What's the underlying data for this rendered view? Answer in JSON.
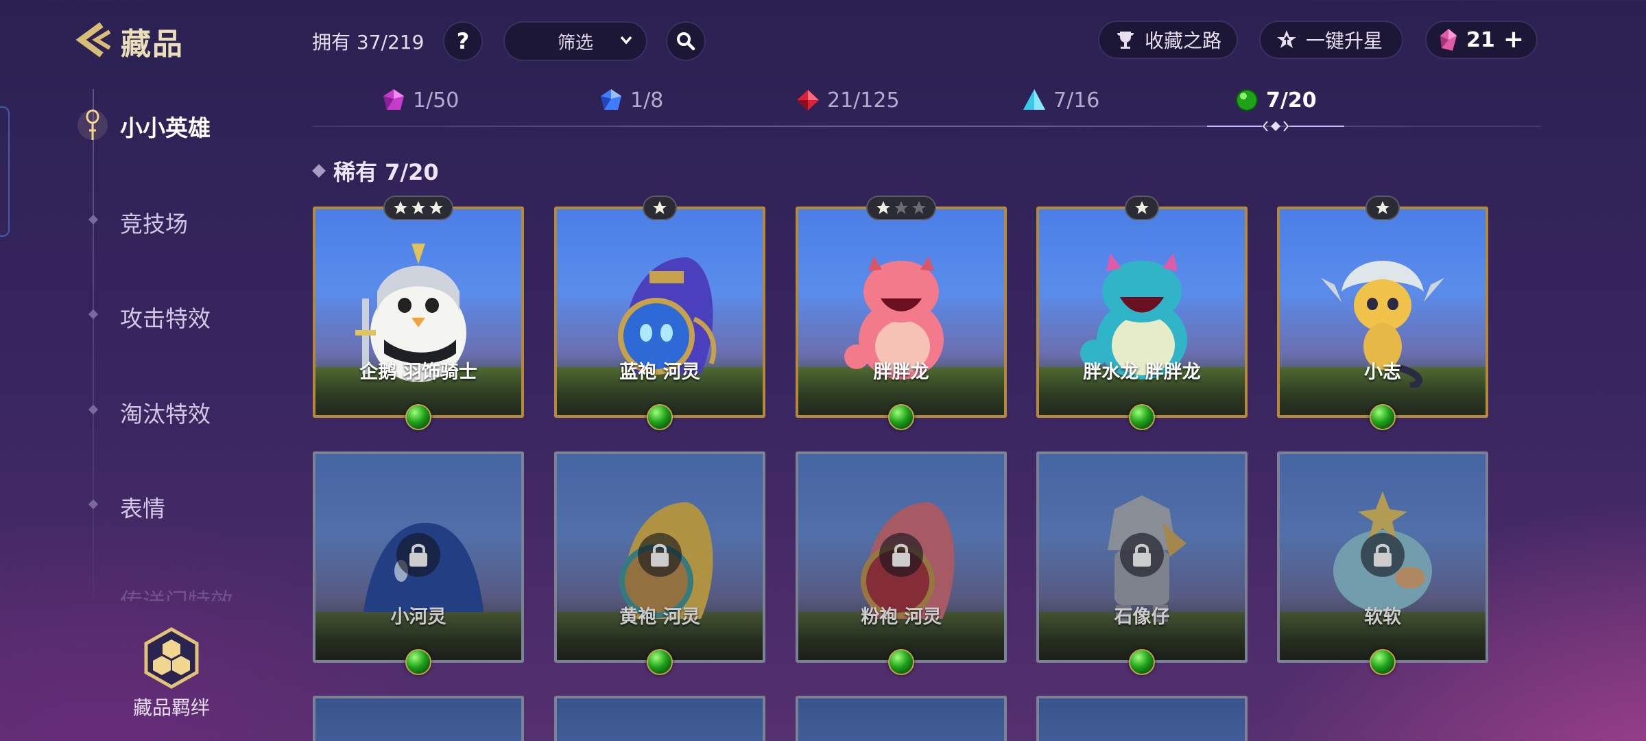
{
  "header": {
    "title": "藏品",
    "owned": "拥有 37/219",
    "help": "?",
    "filter_label": "筛选",
    "road_label": "收藏之路",
    "upstar_label": "一键升星",
    "gem_count": "21",
    "plus": "+"
  },
  "tabs": [
    {
      "label": "1/50",
      "gem": "purple-gem-icon",
      "color": "#c53cc8"
    },
    {
      "label": "1/8",
      "gem": "blue-gem-icon",
      "color": "#3f7cff"
    },
    {
      "label": "21/125",
      "gem": "red-gem-icon",
      "color": "#d8223a"
    },
    {
      "label": "7/16",
      "gem": "cyan-gem-icon",
      "color": "#38c8e8"
    },
    {
      "label": "7/20",
      "gem": "green-gem-icon",
      "color": "#20a81c",
      "active": true
    }
  ],
  "section": {
    "title": "稀有 7/20"
  },
  "sidebar": {
    "items": [
      {
        "label": "小小英雄",
        "active": true
      },
      {
        "label": "竞技场"
      },
      {
        "label": "攻击特效"
      },
      {
        "label": "淘汰特效"
      },
      {
        "label": "表情"
      },
      {
        "label": "传送门特效"
      }
    ],
    "bond_label": "藏品羁绊"
  },
  "cards": [
    {
      "name": "企鹅 羽饰骑士",
      "stars": 3,
      "max_stars": 3,
      "locked": false
    },
    {
      "name": "蓝袍 河灵",
      "stars": 1,
      "max_stars": 1,
      "locked": false
    },
    {
      "name": "胖胖龙",
      "stars": 1,
      "max_stars": 3,
      "locked": false
    },
    {
      "name": "胖水龙 胖胖龙",
      "stars": 1,
      "max_stars": 1,
      "locked": false
    },
    {
      "name": "小志",
      "stars": 1,
      "max_stars": 1,
      "locked": false
    },
    {
      "name": "小河灵",
      "locked": true
    },
    {
      "name": "黄袍 河灵",
      "locked": true
    },
    {
      "name": "粉袍 河灵",
      "locked": true
    },
    {
      "name": "石像仔",
      "locked": true
    },
    {
      "name": "软软",
      "locked": true
    }
  ],
  "colors": {
    "accent_gold": "#b4893a",
    "rarity_green": "#20a81c",
    "locked_border": "#7c8296"
  }
}
